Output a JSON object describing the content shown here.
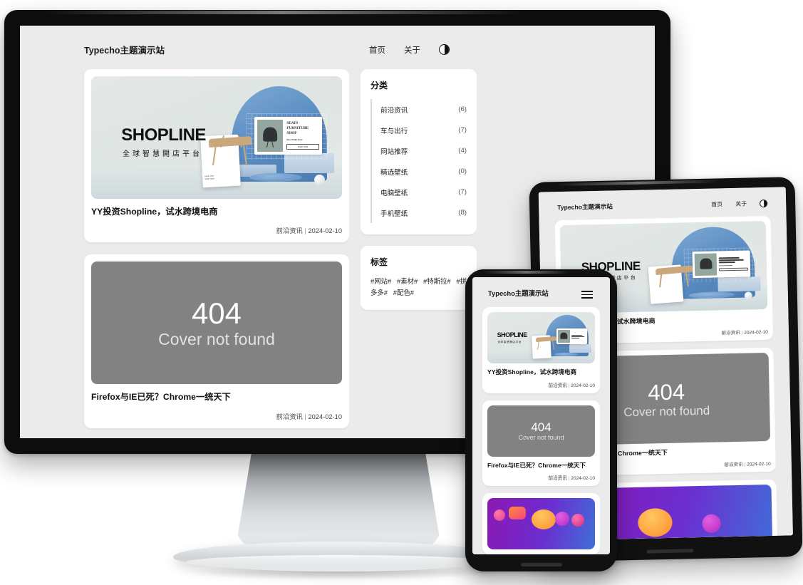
{
  "site": {
    "brand": "Typecho主题演示站",
    "nav": [
      {
        "label": "首页",
        "name": "nav-home"
      },
      {
        "label": "关于",
        "name": "nav-about"
      }
    ],
    "theme_toggle_icon": "half-circle-contrast-icon",
    "menu_icon": "hamburger-menu-icon"
  },
  "posts": [
    {
      "title": "YY投资Shopline，试水跨境电商",
      "category": "前沿资讯",
      "date": "2024-02-10",
      "cover_type": "shopline",
      "cover": {
        "logo": "SHOPLINE",
        "tagline": "全球智慧開店平台",
        "screen_heading_1": "SEATS",
        "screen_heading_2": "FURNITURE",
        "screen_heading_3": "SHOP",
        "screen_sub": "Best Chair Ever",
        "screen_button": "SHOP NOW"
      }
    },
    {
      "title": "Firefox与IE已死？Chrome一统天下",
      "category": "前沿资讯",
      "date": "2024-02-10",
      "cover_type": "404",
      "cover": {
        "code": "404",
        "message": "Cover not found"
      }
    },
    {
      "title": "",
      "category": "",
      "date": "",
      "cover_type": "social",
      "cover": {}
    }
  ],
  "meta_separator": "|",
  "sidebar": {
    "categories": {
      "title": "分类",
      "items": [
        {
          "label": "前沿资讯",
          "count": "(6)"
        },
        {
          "label": "车与出行",
          "count": "(7)"
        },
        {
          "label": "网站推荐",
          "count": "(4)"
        },
        {
          "label": "精选壁纸",
          "count": "(0)"
        },
        {
          "label": "电脑壁纸",
          "count": "(7)"
        },
        {
          "label": "手机壁纸",
          "count": "(8)"
        }
      ]
    },
    "tags": {
      "title": "标签",
      "items": [
        "#网站#",
        "#素材#",
        "#特斯拉#",
        "#拼多多#",
        "#配色#"
      ]
    }
  },
  "colors": {
    "page_background": "#ffffff",
    "screen_background": "#ebebeb",
    "card_background": "#ffffff",
    "device_bezel": "#111111",
    "placeholder_gray": "#828282",
    "shopline_blue": "#5d8fc4",
    "social_purple": "#7a22c4",
    "social_blue": "#3f6fd8"
  }
}
